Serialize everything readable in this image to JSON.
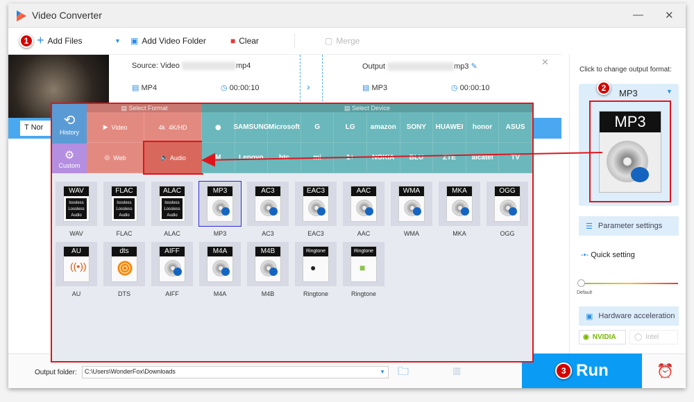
{
  "app": {
    "title": "Video Converter",
    "accent": "#0a9cf5",
    "highlight": "#e0141b"
  },
  "toolbar": {
    "add_files": "Add Files",
    "add_folder": "Add Video Folder",
    "clear": "Clear",
    "merge": "Merge",
    "step1": "1"
  },
  "file": {
    "source_label": "Source: Video",
    "source_ext": "mp4",
    "source_format": "MP4",
    "source_duration": "00:00:10",
    "output_label": "Output",
    "output_ext": "mp3",
    "output_format": "MP3",
    "output_duration": "00:00:10",
    "subtitle_stub": "Nor"
  },
  "popup": {
    "select_format": "Select Format",
    "select_device": "Select Device",
    "history": "History",
    "custom": "Custom",
    "formats": [
      "Video",
      "4K/HD",
      "Web",
      "Audio"
    ],
    "devices_row1": [
      "",
      "SAMSUNG",
      "Microsoft",
      "G",
      "LG",
      "amazon",
      "SONY",
      "HUAWEI",
      "honor",
      "ASUS"
    ],
    "devices_row2": [
      "M",
      "Lenovo",
      "htc",
      "mi",
      "1+",
      "NOKIA",
      "BLU",
      "ZTE",
      "alcatel",
      "TV"
    ],
    "audio_formats": [
      {
        "tag": "WAV",
        "label": "WAV",
        "type": "lossless"
      },
      {
        "tag": "FLAC",
        "label": "FLAC",
        "type": "lossless"
      },
      {
        "tag": "ALAC",
        "label": "ALAC",
        "type": "lossless"
      },
      {
        "tag": "MP3",
        "label": "MP3",
        "type": "disc",
        "selected": true
      },
      {
        "tag": "AC3",
        "label": "AC3",
        "type": "disc"
      },
      {
        "tag": "EAC3",
        "label": "EAC3",
        "type": "disc"
      },
      {
        "tag": "AAC",
        "label": "AAC",
        "type": "disc"
      },
      {
        "tag": "WMA",
        "label": "WMA",
        "type": "disc"
      },
      {
        "tag": "MKA",
        "label": "MKA",
        "type": "disc"
      },
      {
        "tag": "OGG",
        "label": "OGG",
        "type": "disc"
      },
      {
        "tag": "AU",
        "label": "AU",
        "type": "au"
      },
      {
        "tag": "dts",
        "label": "DTS",
        "type": "dts"
      },
      {
        "tag": "AIFF",
        "label": "AIFF",
        "type": "disc"
      },
      {
        "tag": "M4A",
        "label": "M4A",
        "type": "disc"
      },
      {
        "tag": "M4B",
        "label": "M4B",
        "type": "disc"
      },
      {
        "tag": "Ringtone",
        "label": "Ringtone",
        "type": "apple"
      },
      {
        "tag": "Ringtone",
        "label": "Ringtone",
        "type": "android"
      }
    ],
    "lossless_text": "Lossless Audio"
  },
  "right": {
    "hint": "Click to change output format:",
    "format": "MP3",
    "step2": "2",
    "param": "Parameter settings",
    "quick": "Quick setting",
    "default": "Default",
    "quality_level": 0,
    "hw": "Hardware acceleration",
    "nvidia": "NVIDIA",
    "intel": "Intel"
  },
  "bottom": {
    "label": "Output folder:",
    "path": "C:\\Users\\WonderFox\\Downloads",
    "run": "Run",
    "step3": "3"
  }
}
